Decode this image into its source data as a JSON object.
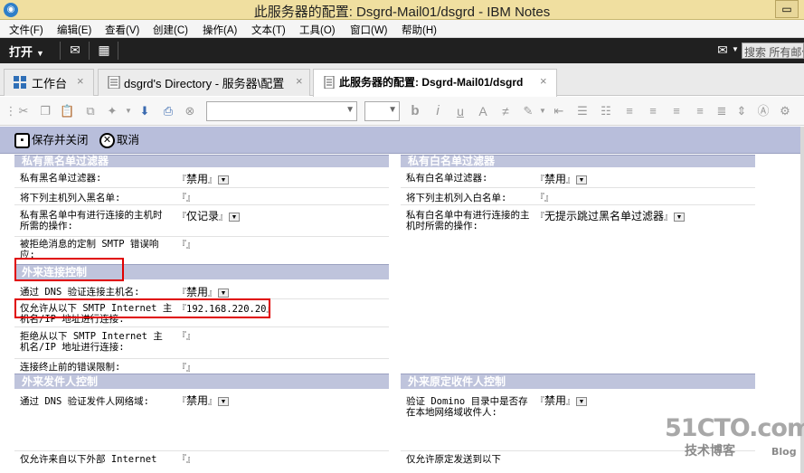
{
  "window": {
    "title": "此服务器的配置: Dsgrd-Mail01/dsgrd - IBM Notes",
    "restore_glyph": "▭"
  },
  "menu": [
    "文件(F)",
    "编辑(E)",
    "查看(V)",
    "创建(C)",
    "操作(A)",
    "文本(T)",
    "工具(O)",
    "窗口(W)",
    "帮助(H)"
  ],
  "toolbar": {
    "open_label": "打开",
    "search_placeholder": "搜索 所有邮件"
  },
  "tabs": [
    {
      "label": "工作台",
      "icon": "workspace-icon",
      "close": "×"
    },
    {
      "label": "dsgrd's Directory - 服务器\\配置",
      "icon": "directory-icon",
      "close": "×"
    },
    {
      "label": "此服务器的配置: Dsgrd-Mail01/dsgrd",
      "icon": "document-icon",
      "close": "×",
      "active": true
    }
  ],
  "actions": {
    "save_close": "保存并关闭",
    "cancel": "取消"
  },
  "form": {
    "private_blacklist": {
      "header": "私有黑名单过滤器",
      "rows": [
        {
          "label": "私有黑名单过滤器:",
          "value": "禁用"
        },
        {
          "label": "将下列主机列入黑名单:",
          "value": ""
        },
        {
          "label": "私有黑名单中有进行连接的主机时所需的操作:",
          "value": "仅记录"
        },
        {
          "label": "被拒绝消息的定制 SMTP 错误响应:",
          "value": ""
        }
      ]
    },
    "private_whitelist": {
      "header": "私有白名单过滤器",
      "rows": [
        {
          "label": "私有白名单过滤器:",
          "value": "禁用"
        },
        {
          "label": "将下列主机列入白名单:",
          "value": ""
        },
        {
          "label": "私有白名单中有进行连接的主机时所需的操作:",
          "value": "无提示跳过黑名单过滤器"
        }
      ]
    },
    "inbound_connection": {
      "header": "外来连接控制",
      "rows": [
        {
          "label": "通过 DNS 验证连接主机名:",
          "value": "禁用"
        },
        {
          "label": "仅允许从以下 SMTP Internet 主机名/IP 地址进行连接:",
          "value": "192.168.220.20"
        },
        {
          "label": "拒绝从以下 SMTP Internet 主机名/IP 地址进行连接:",
          "value": ""
        },
        {
          "label": "连接终止前的错误限制:",
          "value": ""
        }
      ]
    },
    "inbound_sender": {
      "header": "外来发件人控制",
      "rows": [
        {
          "label": "通过 DNS 验证发件人网络域:",
          "value": "禁用"
        },
        {
          "label": "仅允许来自以下外部 Internet",
          "value": ""
        }
      ]
    },
    "inbound_recipient": {
      "header": "外来原定收件人控制",
      "rows": [
        {
          "label": "验证 Domino 目录中是否存在本地网络域收件人:",
          "value": "禁用"
        },
        {
          "label": "仅允许原定发送到以下",
          "value": ""
        }
      ]
    }
  },
  "watermark": {
    "main": "51CTO.com",
    "sub": "技术博客",
    "blog": "Blog"
  },
  "colors": {
    "titlebar": "#f0dfa0",
    "darkbar": "#202020",
    "actionbar": "#b8bedb",
    "section_header": "#bfc4dc",
    "highlight": "#e00000"
  }
}
